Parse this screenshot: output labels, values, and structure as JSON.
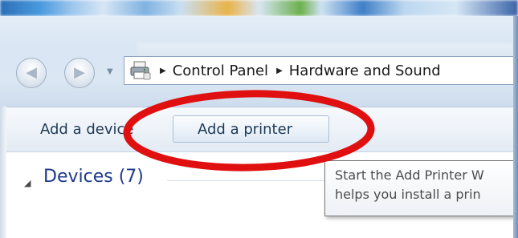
{
  "navigation": {
    "back_icon": "back-arrow-icon",
    "forward_icon": "forward-arrow-icon",
    "history_icon": "chevron-down-icon"
  },
  "address_bar": {
    "location_icon": "printer-icon",
    "separator_glyph": "▶",
    "crumbs": [
      "Control Panel",
      "Hardware and Sound"
    ]
  },
  "command_bar": {
    "add_device_label": "Add a device",
    "add_printer_label": "Add a printer"
  },
  "content": {
    "group_title": "Devices (7)",
    "group_toggle_icon": "collapse-triangle-icon"
  },
  "tooltip": {
    "line1": "Start the Add Printer W",
    "line2": "helps you install a prin"
  },
  "annotation": {
    "color": "#e01010"
  }
}
